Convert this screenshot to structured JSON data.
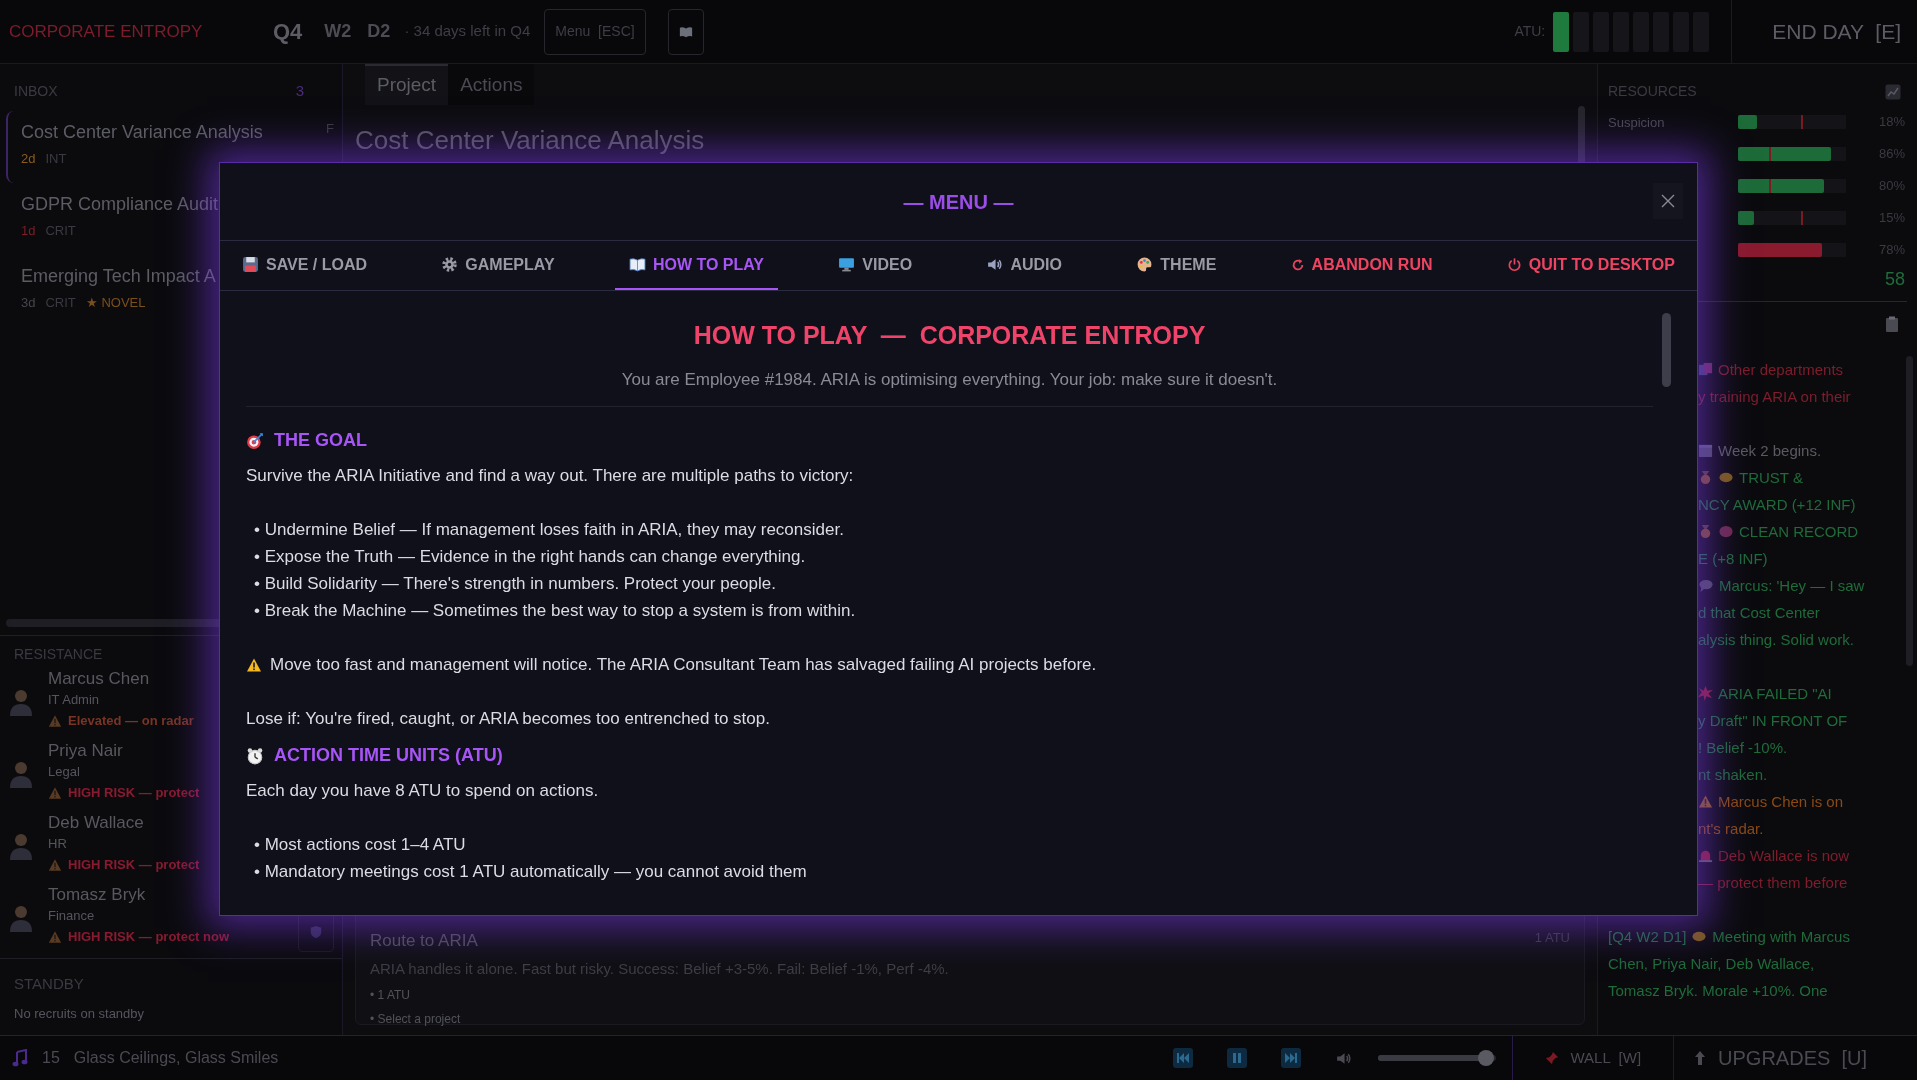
{
  "top_bar": {
    "title": "CORPORATE ENTROPY",
    "quarter": "Q4",
    "week": "W2",
    "day": "D2",
    "days_left": "· 34 days left in Q4",
    "menu_button": "Menu  [ESC]",
    "atu": {
      "label": "ATU:",
      "cells": [
        {
          "filled": true
        },
        {
          "filled": false
        },
        {
          "filled": false
        },
        {
          "filled": false
        },
        {
          "filled": false
        },
        {
          "filled": false
        },
        {
          "filled": false
        },
        {
          "filled": false
        }
      ]
    },
    "end_day": "END DAY  [E]"
  },
  "inbox": {
    "title": "INBOX",
    "count": "3",
    "items": [
      {
        "title": "Cost Center Variance Analysis",
        "key": "F",
        "due": "2d",
        "color": "#8a5a1e",
        "tags": [
          {
            "label": "INT",
            "kind": "plain"
          }
        ],
        "selected": true
      },
      {
        "title": "GDPR Compliance Audit",
        "due": "1d",
        "color": "#7a1f2a",
        "tags": [
          {
            "label": "CRIT",
            "kind": "plain"
          }
        ],
        "selected": false
      },
      {
        "title": "Emerging Tech Impact A",
        "due": "3d",
        "color": "#45454c",
        "tags": [
          {
            "label": "CRIT",
            "kind": "plain"
          },
          {
            "label": "★ NOVEL",
            "kind": "novel"
          }
        ],
        "selected": false
      }
    ]
  },
  "resistance": {
    "title": "RESISTANCE",
    "people": [
      {
        "name": "Marcus Chen",
        "role": "IT Admin",
        "warning": "Elevated — on radar",
        "color": "#7a3424"
      },
      {
        "name": "Priya Nair",
        "role": "Legal",
        "warning": "HIGH RISK — protect",
        "color": "#8a1a30"
      },
      {
        "name": "Deb Wallace",
        "role": "HR",
        "warning": "HIGH RISK — protect",
        "color": "#8a1a30"
      },
      {
        "name": "Tomasz Bryk",
        "role": "Finance",
        "warning": "HIGH RISK — protect now",
        "color": "#8a1a30"
      }
    ]
  },
  "standby": {
    "title": "STANDBY",
    "empty_text": "No recruits on standby"
  },
  "main": {
    "tabs": [
      {
        "label": "Project",
        "selected": true
      },
      {
        "label": "Actions",
        "selected": false
      }
    ],
    "title": "Cost Center Variance Analysis",
    "action_card": {
      "title": "Route to ARIA",
      "cost": "1 ATU",
      "description": "ARIA handles it alone. Fast but risky. Success: Belief +3-5%. Fail: Belief -1%, Perf -4%.",
      "bullets": [
        "• 1 ATU",
        "• Select a project"
      ]
    }
  },
  "resources": {
    "title": "RESOURCES",
    "rows": [
      {
        "label": "Suspicion",
        "level": 0.18,
        "marker": {
          "level": 0.58
        },
        "color": "#1d6b38",
        "value": "18%"
      },
      {
        "level": 0.86,
        "marker": {
          "level": 0.29
        },
        "color": "#1d6b38",
        "value": "86%"
      },
      {
        "level": 0.8,
        "marker": {
          "level": 0.29
        },
        "color": "#1d6b38",
        "value": "80%"
      },
      {
        "level": 0.15,
        "marker": {
          "level": 0.58
        },
        "color": "#1d6b38",
        "value": "15%"
      },
      {
        "level": 0.78,
        "color": "#8a1a2e",
        "value": "78%"
      }
    ],
    "total": "58"
  },
  "log": {
    "entries": [
      {
        "kind": "covered",
        "color": "#7f1d2d",
        "lines": [
          "Other departments",
          "y training ARIA on their"
        ],
        "continues": true
      },
      {
        "kind": "covered",
        "color": "#5a5a62",
        "lines": [
          "Week 2 begins."
        ],
        "continues": false
      },
      {
        "kind": "covered",
        "color": "#1f6b3a",
        "lines": [
          "TRUST &",
          "NCY AWARD (+12 INF)"
        ],
        "continues": false
      },
      {
        "kind": "covered",
        "color": "#1f6b3a",
        "lines": [
          "CLEAN RECORD",
          "E (+8 INF)"
        ],
        "continues": false
      },
      {
        "kind": "covered",
        "color": "#1f6b3a",
        "lines": [
          "Marcus: 'Hey — I saw",
          "d that Cost Center",
          "alysis thing. Solid work."
        ],
        "continues": true
      },
      {
        "kind": "covered",
        "color": "#1f6b3a",
        "lines": [
          "ARIA FAILED \"AI",
          "y Draft\" IN FRONT OF",
          "! Belief -10%.",
          "nt shaken."
        ],
        "continues": false
      },
      {
        "kind": "covered",
        "color": "#8a4a14",
        "lines": [
          "Marcus Chen is on",
          "nt's radar."
        ],
        "continues": false
      },
      {
        "kind": "covered",
        "color": "#7f1d2d",
        "lines": [
          "Deb Wallace is now",
          "— protect them before"
        ],
        "continues": true
      },
      {
        "kind": "full",
        "color": "#1f6b3a",
        "stamp": "[Q4 W2 D1]",
        "lines": [
          "Meeting with Marcus",
          "Chen, Priya Nair, Deb Wallace,",
          "Tomasz Bryk. Morale +10%. One"
        ],
        "continues": false
      }
    ]
  },
  "modal": {
    "title": "— MENU —",
    "tabs": [
      {
        "label": "SAVE / LOAD",
        "kind": "normal",
        "selected": false
      },
      {
        "label": "GAMEPLAY",
        "kind": "normal",
        "selected": false
      },
      {
        "label": "HOW TO PLAY",
        "kind": "normal",
        "selected": true
      },
      {
        "label": "VIDEO",
        "kind": "normal",
        "selected": false
      },
      {
        "label": "AUDIO",
        "kind": "normal",
        "selected": false
      },
      {
        "label": "THEME",
        "kind": "normal",
        "selected": false
      },
      {
        "label": "ABANDON RUN",
        "kind": "danger",
        "selected": false
      },
      {
        "label": "QUIT TO DESKTOP",
        "kind": "danger",
        "selected": false
      }
    ],
    "guide": {
      "title": "HOW TO PLAY  —  CORPORATE ENTROPY",
      "subtitle": "You are Employee #1984. ARIA is optimising everything. Your job: make sure it doesn't.",
      "sections": [
        {
          "heading": "THE GOAL",
          "blocks": [
            {
              "kind": "paragraph",
              "text": "Survive the ARIA Initiative and find a way out. There are multiple paths to victory:"
            },
            {
              "kind": "bullets",
              "items": [
                "• Undermine Belief — If management loses faith in ARIA, they may reconsider.",
                "• Expose the Truth — Evidence in the right hands can change everything.",
                "• Build Solidarity — There's strength in numbers. Protect your people.",
                "• Break the Machine — Sometimes the best way to stop a system is from within."
              ]
            },
            {
              "kind": "warning",
              "text": "Move too fast and management will notice. The ARIA Consultant Team has salvaged failing AI projects before."
            },
            {
              "kind": "paragraph",
              "text": "Lose if: You're fired, caught, or ARIA becomes too entrenched to stop."
            }
          ]
        },
        {
          "heading": "ACTION TIME UNITS (ATU)",
          "blocks": [
            {
              "kind": "paragraph",
              "text": "Each day you have 8 ATU to spend on actions."
            },
            {
              "kind": "bullets",
              "items": [
                "• Most actions cost 1–4 ATU",
                "• Mandatory meetings cost 1 ATU automatically — you cannot avoid them"
              ]
            }
          ]
        }
      ]
    }
  },
  "bottom_bar": {
    "track_number": "15",
    "track_title": "Glass Ceilings, Glass Smiles",
    "volume": {
      "level": 0.92
    },
    "wall_button": "WALL  [W]",
    "upgrades_button": "UPGRADES  [U]"
  }
}
